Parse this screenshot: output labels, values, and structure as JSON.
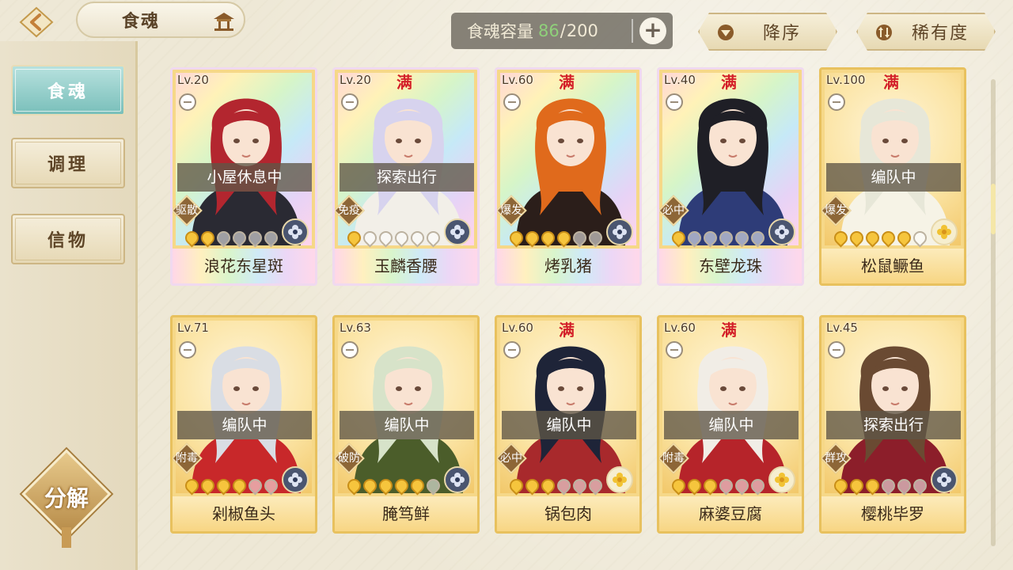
{
  "header": {
    "title": "食魂",
    "capacity_label": "食魂容量",
    "capacity_current": "86",
    "capacity_separator": "/",
    "capacity_max": "200",
    "plus_label": "+",
    "sort_order_label": "降序",
    "sort_rarity_label": "稀有度"
  },
  "sidebar": {
    "tabs": [
      {
        "label": "食魂",
        "active": true
      },
      {
        "label": "调理",
        "active": false
      },
      {
        "label": "信物",
        "active": false
      }
    ],
    "decompose_label": "分解"
  },
  "full_badge": "满",
  "cards": [
    {
      "level": "Lv.20",
      "name": "浪花东星斑",
      "status": "小屋休息中",
      "tag": "驱散",
      "full": false,
      "stars": 2,
      "frame": "rainbow",
      "element": "blue",
      "hair": "#b3262f",
      "outfit": "#2a2a33"
    },
    {
      "level": "Lv.20",
      "name": "玉麟香腰",
      "status": "探索出行",
      "tag": "免疫",
      "full": true,
      "stars": 1,
      "frame": "rainbow",
      "element": "blue",
      "hair": "#d7d3ee",
      "outfit": "#f2efe8"
    },
    {
      "level": "Lv.60",
      "name": "烤乳猪",
      "status": "",
      "tag": "爆发",
      "full": true,
      "stars": 4,
      "frame": "rainbow",
      "element": "blue",
      "hair": "#e06a1c",
      "outfit": "#2b1e1a"
    },
    {
      "level": "Lv.40",
      "name": "东壁龙珠",
      "status": "",
      "tag": "必中",
      "full": true,
      "stars": 1,
      "frame": "rainbow",
      "element": "blue",
      "hair": "#1f1f26",
      "outfit": "#2e3c78"
    },
    {
      "level": "Lv.100",
      "name": "松鼠鳜鱼",
      "status": "编队中",
      "tag": "爆发",
      "full": true,
      "stars": 5,
      "frame": "gold",
      "element": "gold",
      "hair": "#e7e7d8",
      "outfit": "#f6f3e6"
    },
    {
      "level": "Lv.71",
      "name": "剁椒鱼头",
      "status": "编队中",
      "tag": "附毒",
      "full": false,
      "stars": 4,
      "frame": "gold",
      "element": "blue",
      "hair": "#d9dde4",
      "outfit": "#c8282a"
    },
    {
      "level": "Lv.63",
      "name": "腌笃鲜",
      "status": "编队中",
      "tag": "破防",
      "full": false,
      "stars": 5,
      "frame": "gold",
      "element": "blue",
      "hair": "#d7e3c9",
      "outfit": "#4b5d2a"
    },
    {
      "level": "Lv.60",
      "name": "锅包肉",
      "status": "编队中",
      "tag": "必中",
      "full": true,
      "stars": 3,
      "frame": "gold",
      "element": "gold",
      "hair": "#1e2438",
      "outfit": "#a8292c"
    },
    {
      "level": "Lv.60",
      "name": "麻婆豆腐",
      "status": "编队中",
      "tag": "附毒",
      "full": true,
      "stars": 3,
      "frame": "gold",
      "element": "gold",
      "hair": "#f1ede6",
      "outfit": "#b6242a"
    },
    {
      "level": "Lv.45",
      "name": "樱桃毕罗",
      "status": "探索出行",
      "tag": "群攻",
      "full": false,
      "stars": 3,
      "frame": "gold",
      "element": "blue",
      "hair": "#6a4a32",
      "outfit": "#8c1e2a"
    }
  ]
}
